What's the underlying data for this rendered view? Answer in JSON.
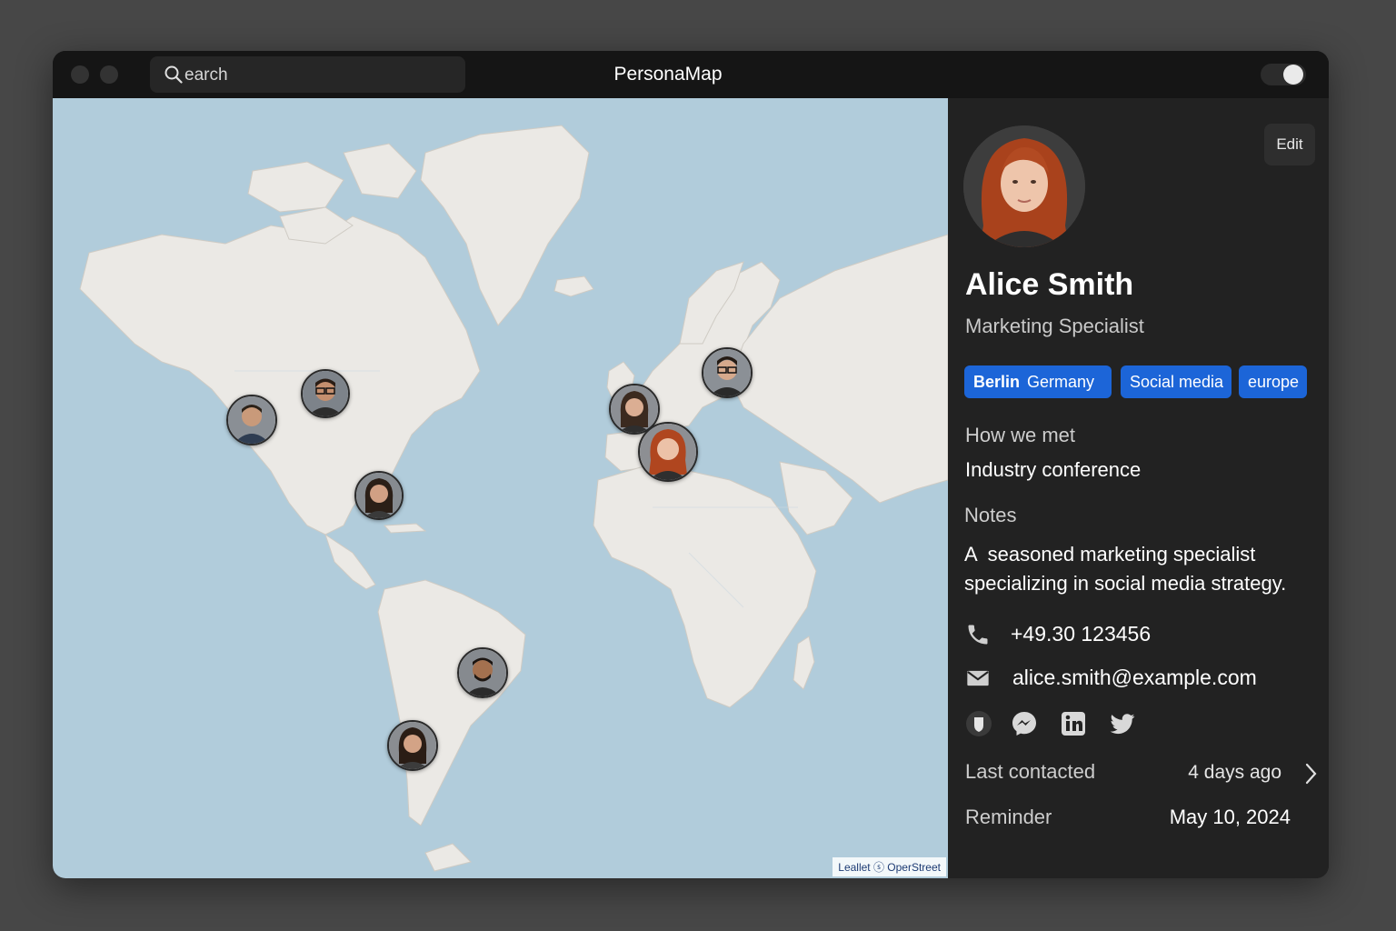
{
  "app": {
    "title": "PersonaMap"
  },
  "search": {
    "text": "earch"
  },
  "toolbar": {
    "edit_label": "Edit",
    "theme_toggle": "on"
  },
  "map": {
    "attribution": "Leallet ⓢ OperStreet"
  },
  "contacts_on_map": [
    {
      "name": "west-coast-contact"
    },
    {
      "name": "midwest-contact"
    },
    {
      "name": "east-us-contact"
    },
    {
      "name": "uk-contact"
    },
    {
      "name": "alice-smith"
    },
    {
      "name": "scandinavia-contact"
    },
    {
      "name": "brazil-contact"
    },
    {
      "name": "argentina-contact"
    }
  ],
  "profile": {
    "name": "Alice Smith",
    "title": "Marketing Specialist",
    "tags": [
      {
        "primary": "Berlin",
        "secondary": "Germany"
      },
      {
        "primary": "Social media"
      },
      {
        "primary": "europe"
      }
    ],
    "how_we_met_label": "How we met",
    "how_we_met": "Industry conference",
    "notes_label": "Notes",
    "notes": "A  seasoned marketing specialist specializing in social media strategy.",
    "phone": "+49.30 123456",
    "email": "alice.smith@example.com",
    "social_icons": [
      "shield-icon",
      "messenger-icon",
      "linkedin-icon",
      "twitter-icon"
    ],
    "last_contacted_label": "Last contacted",
    "last_contacted": "4 days ago",
    "reminder_label": "Reminder",
    "reminder": "May 10, 2024"
  },
  "colors": {
    "accent": "#1c65d8",
    "panel": "#222222",
    "map_water": "#b1ccdb",
    "map_land": "#ebe9e5"
  }
}
